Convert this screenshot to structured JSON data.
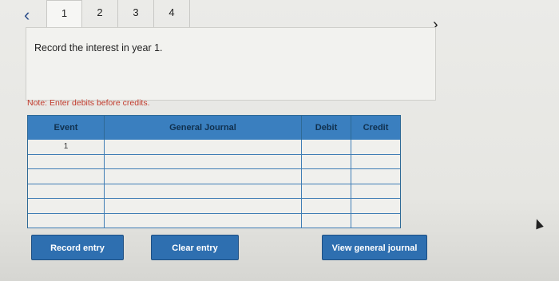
{
  "nav": {
    "prev_glyph": "‹",
    "next_glyph": "›",
    "steps": [
      "1",
      "2",
      "3",
      "4"
    ],
    "active_step": "1"
  },
  "prompt": {
    "text": "Record the interest in year 1."
  },
  "note": "Note: Enter debits before credits.",
  "journal": {
    "headers": {
      "event": "Event",
      "general_journal": "General Journal",
      "debit": "Debit",
      "credit": "Credit"
    },
    "rows": [
      {
        "event": "1"
      },
      {
        "event": ""
      },
      {
        "event": ""
      },
      {
        "event": ""
      },
      {
        "event": ""
      },
      {
        "event": ""
      }
    ]
  },
  "buttons": {
    "record_entry": "Record entry",
    "clear_entry": "Clear entry",
    "view_general_journal": "View general journal"
  },
  "colors": {
    "accent": "#3a7fbf",
    "note": "#c0392b",
    "button": "#2e6fb0"
  }
}
